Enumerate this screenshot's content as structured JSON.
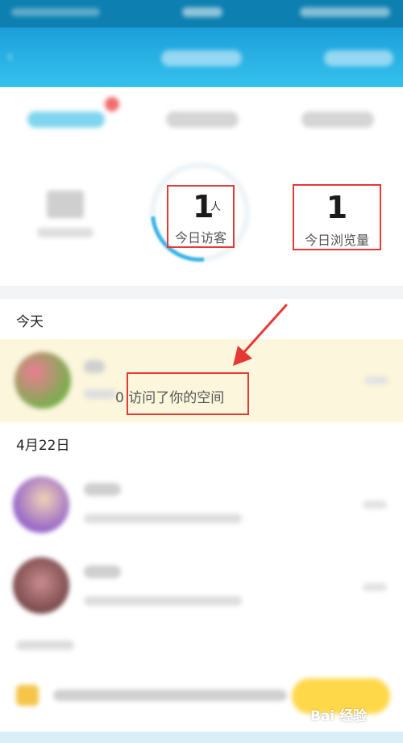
{
  "stats": {
    "visitors_count": "1",
    "visitors_unit": "人",
    "visitors_label": "今日访客",
    "views_count": "1",
    "views_label": "今日浏览量"
  },
  "list": {
    "sections": [
      {
        "header": "今天"
      },
      {
        "header": "4月22日"
      }
    ],
    "highlight_entry": {
      "text": "0 访问了你的空间"
    }
  },
  "watermark": {
    "text": "Bai 经验"
  },
  "colors": {
    "header_blue": "#1c9fd9",
    "annotation_red": "#e53935",
    "highlight_row": "#fbf6dc",
    "ring_accent": "#3cb6e8"
  },
  "icons": [
    "back-arrow-icon",
    "annotation-arrow-icon",
    "crown-icon"
  ]
}
